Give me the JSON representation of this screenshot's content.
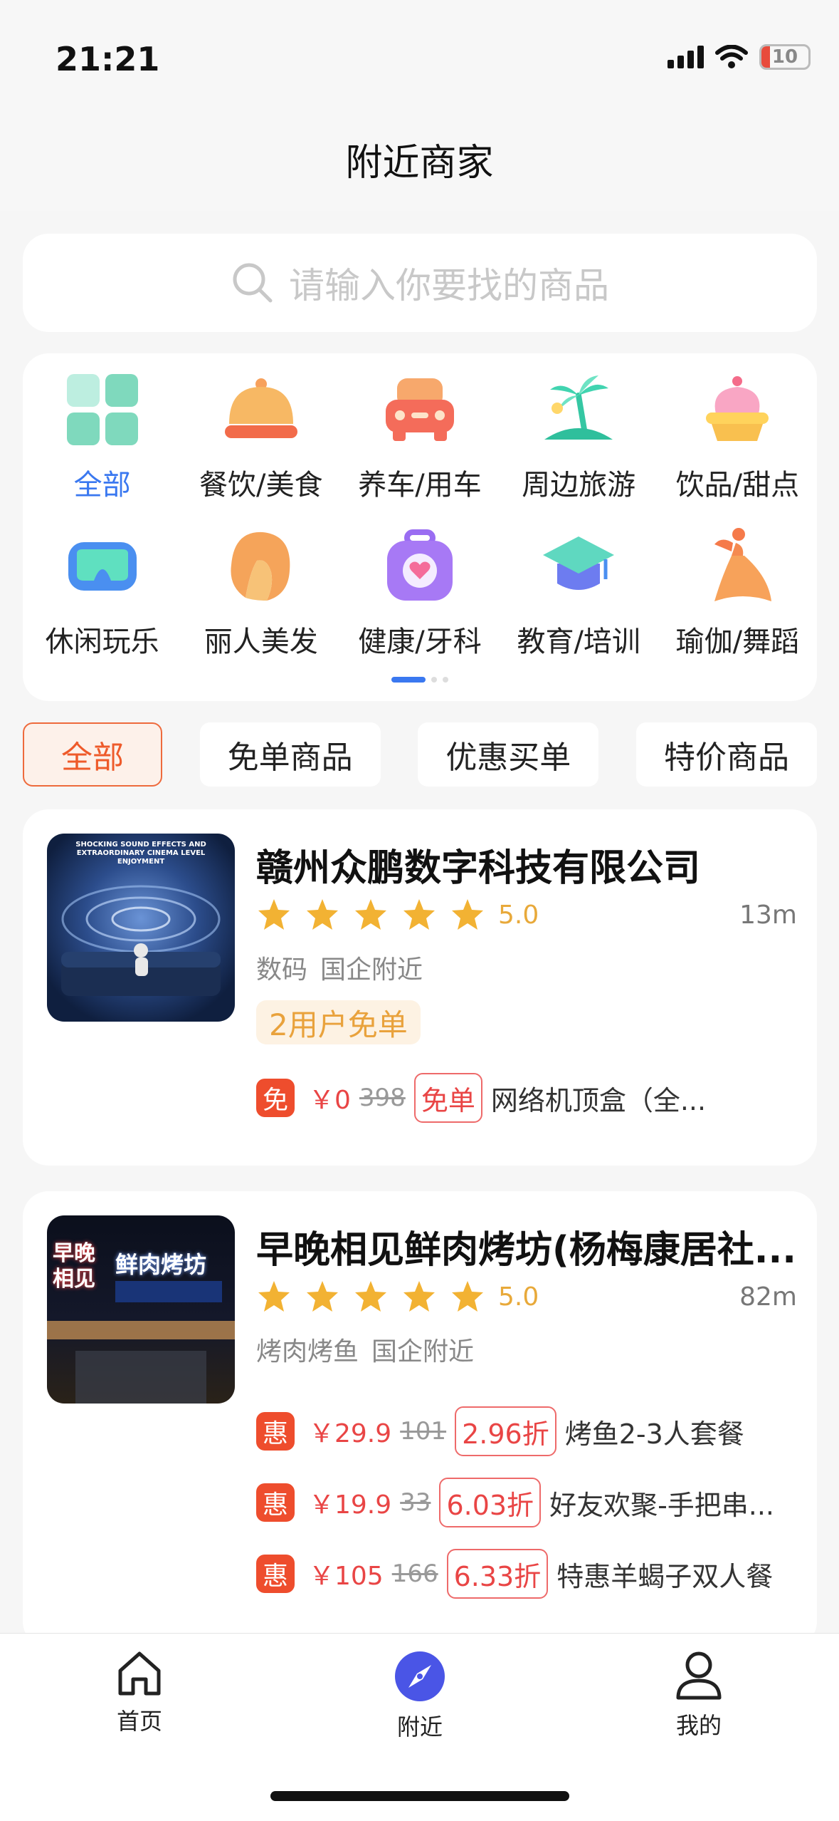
{
  "status_bar": {
    "time": "21:21",
    "battery": "10"
  },
  "header": {
    "title": "附近商家"
  },
  "search": {
    "placeholder": "请输入你要找的商品"
  },
  "categories": [
    {
      "label": "全部",
      "icon": "grid-icon",
      "active": true
    },
    {
      "label": "餐饮/美食",
      "icon": "food-cloche-icon"
    },
    {
      "label": "养车/用车",
      "icon": "car-icon"
    },
    {
      "label": "周边旅游",
      "icon": "palm-island-icon"
    },
    {
      "label": "饮品/甜点",
      "icon": "cupcake-icon"
    },
    {
      "label": "休闲玩乐",
      "icon": "vr-goggles-icon"
    },
    {
      "label": "丽人美发",
      "icon": "woman-hair-icon"
    },
    {
      "label": "健康/牙科",
      "icon": "health-bag-icon"
    },
    {
      "label": "教育/培训",
      "icon": "graduation-cap-icon"
    },
    {
      "label": "瑜伽/舞蹈",
      "icon": "dancer-icon"
    }
  ],
  "filters": [
    {
      "label": "全部",
      "active": true
    },
    {
      "label": "免单商品"
    },
    {
      "label": "优惠买单"
    },
    {
      "label": "特价商品"
    }
  ],
  "shops": [
    {
      "name": "赣州众鹏数字科技有限公司",
      "rating": "5.0",
      "stars": 5,
      "distance": "13m",
      "tags": [
        "数码",
        "国企附近"
      ],
      "free_badge": "2用户免单",
      "thumb_text": "SHOCKING SOUND EFFECTS AND EXTRAORDINARY CINEMA LEVEL ENJOYMENT",
      "deals": [
        {
          "icon": "免",
          "price": "￥0",
          "original": "398",
          "badge": "免单",
          "name": "网络机顶盒（全..."
        }
      ]
    },
    {
      "name": "早晚相见鲜肉烤坊(杨梅康居社...",
      "rating": "5.0",
      "stars": 5,
      "distance": "82m",
      "tags": [
        "烤肉烤鱼",
        "国企附近"
      ],
      "thumb_text_1": "早晚相见",
      "thumb_text_2": "鲜肉烤坊",
      "deals": [
        {
          "icon": "惠",
          "price": "￥29.9",
          "original": "101",
          "badge": "2.96折",
          "name": "烤鱼2-3人套餐"
        },
        {
          "icon": "惠",
          "price": "￥19.9",
          "original": "33",
          "badge": "6.03折",
          "name": "好友欢聚-手把串..."
        },
        {
          "icon": "惠",
          "price": "￥105",
          "original": "166",
          "badge": "6.33折",
          "name": "特惠羊蝎子双人餐"
        }
      ]
    }
  ],
  "tab_bar": [
    {
      "label": "首页",
      "icon": "home-icon"
    },
    {
      "label": "附近",
      "icon": "compass-icon",
      "active": true,
      "accent": "#4a55e6"
    },
    {
      "label": "我的",
      "icon": "user-icon"
    }
  ]
}
